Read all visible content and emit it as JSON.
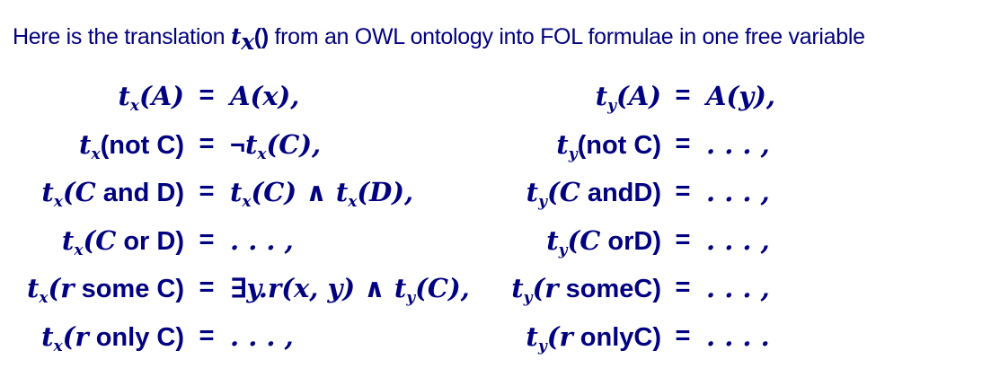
{
  "heading": {
    "prefix": "Here is the translation ",
    "fn_t": "t",
    "fn_sub": "x",
    "fn_parens": "()",
    "suffix": " from an OWL ontology into FOL formulae in one free variable"
  },
  "rows": [
    {
      "left_lhs": [
        {
          "t": "t",
          "s": "serif"
        },
        {
          "t": "x",
          "s": "sub"
        },
        {
          "t": "(",
          "s": "serif"
        },
        {
          "t": "A",
          "s": "serif"
        },
        {
          "t": ")",
          "s": "serif"
        }
      ],
      "left_rhs": [
        {
          "t": "A",
          "s": "serif"
        },
        {
          "t": "(",
          "s": "serif"
        },
        {
          "t": "x",
          "s": "serif"
        },
        {
          "t": "),",
          "s": "serif"
        }
      ],
      "right_lhs": [
        {
          "t": "t",
          "s": "serif"
        },
        {
          "t": "y",
          "s": "sub"
        },
        {
          "t": "(",
          "s": "serif"
        },
        {
          "t": "A",
          "s": "serif"
        },
        {
          "t": ")",
          "s": "serif"
        }
      ],
      "right_rhs": [
        {
          "t": "A",
          "s": "serif"
        },
        {
          "t": "(",
          "s": "serif"
        },
        {
          "t": "y",
          "s": "serif"
        },
        {
          "t": "),",
          "s": "serif"
        }
      ]
    },
    {
      "left_lhs": [
        {
          "t": "t",
          "s": "serif"
        },
        {
          "t": "x",
          "s": "sub"
        },
        {
          "t": "(not C)",
          "s": "sans"
        }
      ],
      "left_rhs": [
        {
          "t": "¬",
          "s": "sans"
        },
        {
          "t": "t",
          "s": "serif"
        },
        {
          "t": "x",
          "s": "sub"
        },
        {
          "t": "(",
          "s": "serif"
        },
        {
          "t": "C",
          "s": "serif"
        },
        {
          "t": "),",
          "s": "serif"
        }
      ],
      "right_lhs": [
        {
          "t": "t",
          "s": "serif"
        },
        {
          "t": "y",
          "s": "sub"
        },
        {
          "t": "(not C)",
          "s": "sans"
        }
      ],
      "right_rhs": [
        {
          "t": ". . . ,",
          "s": "serif"
        }
      ]
    },
    {
      "left_lhs": [
        {
          "t": "t",
          "s": "serif"
        },
        {
          "t": "x",
          "s": "sub"
        },
        {
          "t": "(",
          "s": "serif"
        },
        {
          "t": "C",
          "s": "serif"
        },
        {
          "t": " and D)",
          "s": "sans"
        }
      ],
      "left_rhs": [
        {
          "t": "t",
          "s": "serif"
        },
        {
          "t": "x",
          "s": "sub"
        },
        {
          "t": "(",
          "s": "serif"
        },
        {
          "t": "C",
          "s": "serif"
        },
        {
          "t": ") ∧ ",
          "s": "serif"
        },
        {
          "t": "t",
          "s": "serif"
        },
        {
          "t": "x",
          "s": "sub"
        },
        {
          "t": "(",
          "s": "serif"
        },
        {
          "t": "D",
          "s": "serif"
        },
        {
          "t": "),",
          "s": "serif"
        }
      ],
      "right_lhs": [
        {
          "t": "t",
          "s": "serif"
        },
        {
          "t": "y",
          "s": "sub"
        },
        {
          "t": "(",
          "s": "serif"
        },
        {
          "t": "C",
          "s": "serif"
        },
        {
          "t": " andD)",
          "s": "sans"
        }
      ],
      "right_rhs": [
        {
          "t": ". . . ,",
          "s": "serif"
        }
      ]
    },
    {
      "left_lhs": [
        {
          "t": "t",
          "s": "serif"
        },
        {
          "t": "x",
          "s": "sub"
        },
        {
          "t": "(",
          "s": "serif"
        },
        {
          "t": "C",
          "s": "serif"
        },
        {
          "t": " or D)",
          "s": "sans"
        }
      ],
      "left_rhs": [
        {
          "t": ". . . ,",
          "s": "serif"
        }
      ],
      "right_lhs": [
        {
          "t": "t",
          "s": "serif"
        },
        {
          "t": "y",
          "s": "sub"
        },
        {
          "t": "(",
          "s": "serif"
        },
        {
          "t": "C",
          "s": "serif"
        },
        {
          "t": " orD)",
          "s": "sans"
        }
      ],
      "right_rhs": [
        {
          "t": ". . . ,",
          "s": "serif"
        }
      ]
    },
    {
      "left_lhs": [
        {
          "t": "t",
          "s": "serif"
        },
        {
          "t": "x",
          "s": "sub"
        },
        {
          "t": "(",
          "s": "serif"
        },
        {
          "t": "r",
          "s": "serif"
        },
        {
          "t": " some C)",
          "s": "sans"
        }
      ],
      "left_rhs": [
        {
          "t": "∃",
          "s": "sans"
        },
        {
          "t": "y",
          "s": "serif"
        },
        {
          "t": ".",
          "s": "serif"
        },
        {
          "t": "r",
          "s": "serif"
        },
        {
          "t": "(",
          "s": "serif"
        },
        {
          "t": "x",
          "s": "serif"
        },
        {
          "t": ", ",
          "s": "serif"
        },
        {
          "t": "y",
          "s": "serif"
        },
        {
          "t": ") ∧ ",
          "s": "serif"
        },
        {
          "t": "t",
          "s": "serif"
        },
        {
          "t": "y",
          "s": "sub"
        },
        {
          "t": "(",
          "s": "serif"
        },
        {
          "t": "C",
          "s": "serif"
        },
        {
          "t": "),",
          "s": "serif"
        }
      ],
      "right_lhs": [
        {
          "t": "t",
          "s": "serif"
        },
        {
          "t": "y",
          "s": "sub"
        },
        {
          "t": "(",
          "s": "serif"
        },
        {
          "t": "r",
          "s": "serif"
        },
        {
          "t": " someC)",
          "s": "sans"
        }
      ],
      "right_rhs": [
        {
          "t": ". . . ,",
          "s": "serif"
        }
      ]
    },
    {
      "left_lhs": [
        {
          "t": "t",
          "s": "serif"
        },
        {
          "t": "x",
          "s": "sub"
        },
        {
          "t": "(",
          "s": "serif"
        },
        {
          "t": "r",
          "s": "serif"
        },
        {
          "t": " only C)",
          "s": "sans"
        }
      ],
      "left_rhs": [
        {
          "t": ". . . ,",
          "s": "serif"
        }
      ],
      "right_lhs": [
        {
          "t": "t",
          "s": "serif"
        },
        {
          "t": "y",
          "s": "sub"
        },
        {
          "t": "(",
          "s": "serif"
        },
        {
          "t": "r",
          "s": "serif"
        },
        {
          "t": " onlyC)",
          "s": "sans"
        }
      ],
      "right_rhs": [
        {
          "t": ". . . .",
          "s": "serif"
        }
      ]
    }
  ],
  "equals": "="
}
